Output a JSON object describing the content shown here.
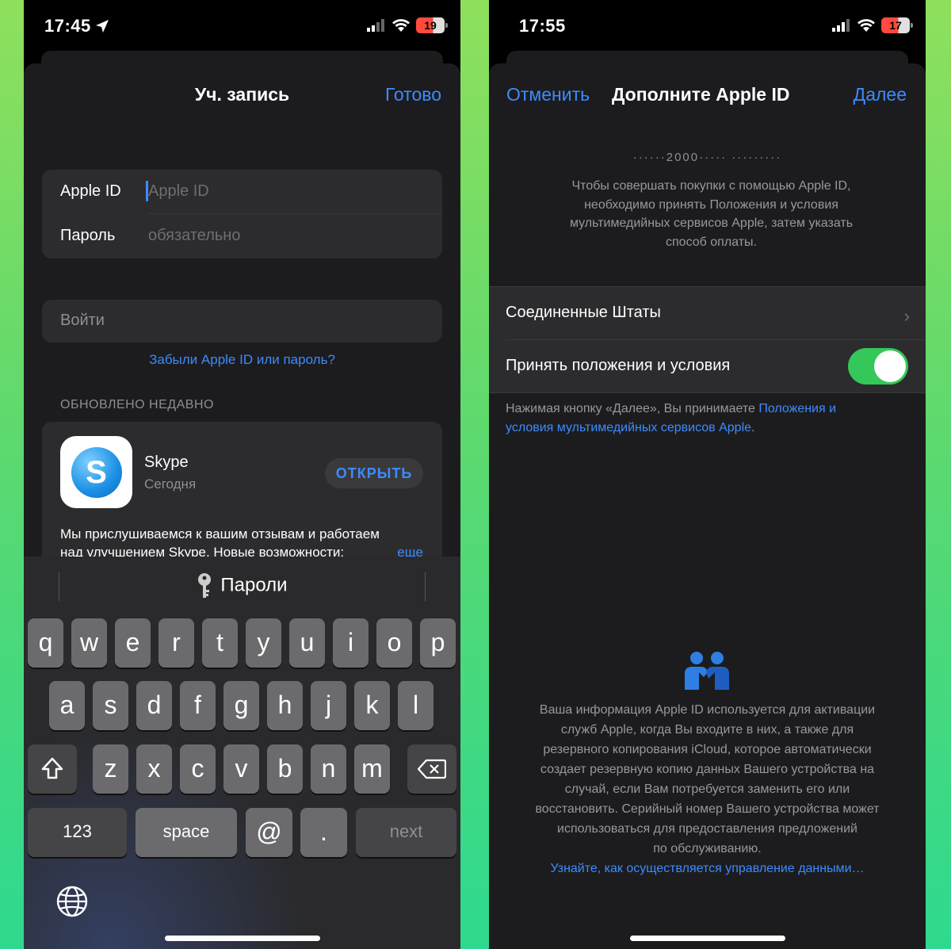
{
  "left": {
    "status": {
      "time": "17:45",
      "battery": "19"
    },
    "nav": {
      "title": "Уч. запись",
      "done": "Готово"
    },
    "form": {
      "appleid_label": "Apple ID",
      "appleid_placeholder": "Apple ID",
      "password_label": "Пароль",
      "password_placeholder": "обязательно"
    },
    "signin": "Войти",
    "forgot": "Забыли Apple ID или пароль?",
    "recent_header": "ОБНОВЛЕНО НЕДАВНО",
    "app": {
      "name": "Skype",
      "date": "Сегодня",
      "icon_letter": "S",
      "open": "ОТКРЫТЬ",
      "notes_line1": "Мы прислушиваемся к вашим отзывам и работаем",
      "notes_line2": "над улучшением Skype. Новые возможности:",
      "more": "еще"
    },
    "keyboard": {
      "suggestion": "Пароли",
      "row1": [
        "q",
        "w",
        "e",
        "r",
        "t",
        "y",
        "u",
        "i",
        "o",
        "p"
      ],
      "row2": [
        "a",
        "s",
        "d",
        "f",
        "g",
        "h",
        "j",
        "k",
        "l"
      ],
      "row3": [
        "z",
        "x",
        "c",
        "v",
        "b",
        "n",
        "m"
      ],
      "k123": "123",
      "space": "space",
      "at": "@",
      "dot": ".",
      "next": "next"
    }
  },
  "right": {
    "status": {
      "time": "17:55",
      "battery": "17"
    },
    "nav": {
      "cancel": "Отменить",
      "title": "Дополните Apple ID",
      "next": "Далее"
    },
    "masked_email": "······2000····· ·········",
    "intro": "Чтобы совершать покупки с помощью Apple ID, необходимо принять Положения и условия мультимедийных сервисов Apple, затем указать способ оплаты.",
    "country": "Соединенные Штаты",
    "accept_terms": "Принять положения и условия",
    "accept_on": true,
    "footnote_text": "Нажимая кнопку «Далее», Вы принимаете ",
    "footnote_link": "Положения и условия мультимедийных сервисов Apple",
    "footnote_end": ".",
    "privacy_lines": [
      "Ваша информация Apple ID используется для активации",
      "служб Apple, когда Вы входите в них, а также для",
      "резервного копирования iCloud, которое автоматически",
      "создает резервную копию данных Вашего устройства на",
      "случай, если Вам потребуется заменить его или",
      "восстановить. Серийный номер Вашего устройства может",
      "использоваться для предоставления предложений",
      "по обслуживанию."
    ],
    "privacy_link": "Узнайте, как осуществляется управление данными…"
  },
  "colors": {
    "accent": "#3d8bff",
    "toggle_on": "#34c759",
    "sheet": "#1c1c1e",
    "cell": "#2c2c2e"
  }
}
